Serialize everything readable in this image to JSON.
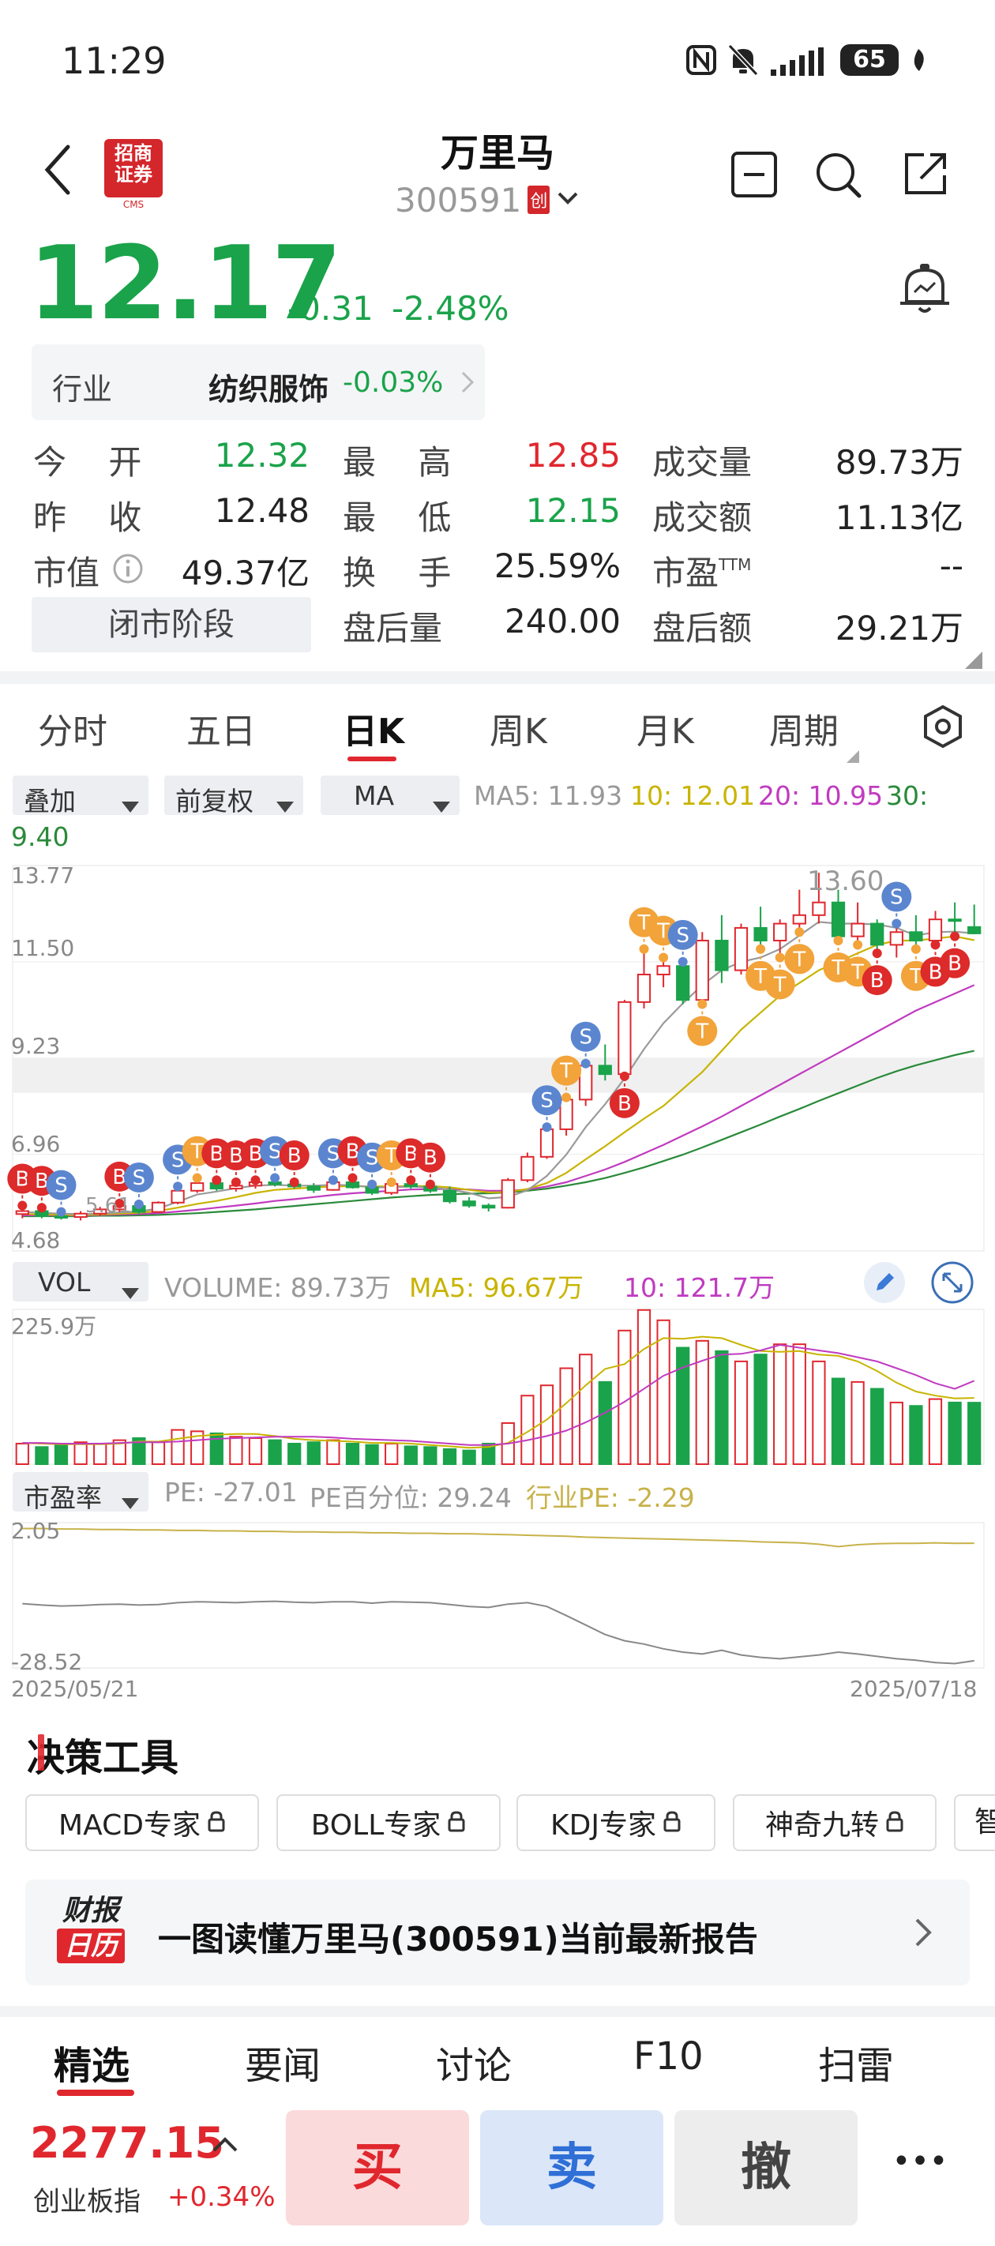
{
  "status_bar": {
    "time": "11:29",
    "battery": "65"
  },
  "header": {
    "logo_top": "招商",
    "logo_bottom": "证券",
    "logo_small": "CMS",
    "title": "万里马",
    "code": "300591",
    "board_badge": "创"
  },
  "price": {
    "last": "12.17",
    "change": "-0.31",
    "change_pct": "-2.48%"
  },
  "industry": {
    "label": "行业",
    "name": "纺织服饰",
    "change": "-0.03%"
  },
  "stats": [
    [
      {
        "k": "今    开",
        "v": "12.32",
        "c": "green"
      },
      {
        "k": "最    高",
        "v": "12.85",
        "c": "red"
      },
      {
        "k": "成交量",
        "v": "89.73万",
        "c": "dark"
      }
    ],
    [
      {
        "k": "昨    收",
        "v": "12.48",
        "c": "dark"
      },
      {
        "k": "最    低",
        "v": "12.15",
        "c": "green"
      },
      {
        "k": "成交额",
        "v": "11.13亿",
        "c": "dark"
      }
    ],
    [
      {
        "k": "市值",
        "v": "49.37亿",
        "c": "dark"
      },
      {
        "k": "换    手",
        "v": "25.59%",
        "c": "dark"
      },
      {
        "k": "市盈TTM",
        "v": "--",
        "c": "dark"
      }
    ],
    [
      {
        "k": "",
        "v": "",
        "c": "dark"
      },
      {
        "k": "盘后量",
        "v": "240.00",
        "c": "dark"
      },
      {
        "k": "盘后额",
        "v": "29.21万",
        "c": "dark"
      }
    ]
  ],
  "phase_button": "闭市阶段",
  "pe_ttm_label": "市盈",
  "pe_ttm_sup": "TTM",
  "chart_tabs": [
    "分时",
    "五日",
    "日K",
    "周K",
    "月K",
    "周期"
  ],
  "active_tab": 2,
  "indicator_bar": {
    "overlay": "叠加",
    "adjust": "前复权",
    "ma": "MA",
    "ma5": "MA5: 11.93",
    "ma10": "10: 12.01",
    "ma20": "20: 10.95",
    "ma30": "30:",
    "ma30_value": "9.40"
  },
  "price_axis": {
    "top": "13.77",
    "l2": "11.50",
    "l3": "9.23",
    "l4": "6.96",
    "bottom": "4.68"
  },
  "annotations": {
    "max": "13.60",
    "min": "5.61"
  },
  "vol_bar": {
    "label": "VOL",
    "volume": "VOLUME: 89.73万",
    "ma5": "MA5: 96.67万",
    "ma10": "10: 121.7万",
    "axis_top": "225.9万"
  },
  "pe_bar": {
    "label": "市盈率",
    "pe": "PE: -27.01",
    "pct": "PE百分位: 29.24",
    "industry": "行业PE: -2.29",
    "axis_top": "2.05",
    "axis_bottom": "-28.52"
  },
  "dates": {
    "start": "2025/05/21",
    "end": "2025/07/18"
  },
  "tools": {
    "title": "决策工具",
    "chips": [
      "MACD专家",
      "BOLL专家",
      "KDJ专家",
      "神奇九转",
      "智"
    ]
  },
  "report": {
    "badge_top": "财报",
    "badge_bottom": "日历",
    "text": "一图读懂万里马(300591)当前最新报告"
  },
  "bottom_tabs": [
    "精选",
    "要闻",
    "讨论",
    "F10",
    "扫雷"
  ],
  "index": {
    "value": "2277.15",
    "name": "创业板指",
    "change": "+0.34%"
  },
  "actions": {
    "buy": "买",
    "sell": "卖",
    "cancel": "撤",
    "more": "•••"
  },
  "colors": {
    "up": "#e0272e",
    "down": "#1aa34a",
    "ma5": "#c8b400",
    "ma10": "#c03bc0",
    "ma30": "#2a8a3a",
    "pe": "#888888",
    "industry_pe": "#c8b24a"
  },
  "chart_data": [
    {
      "type": "candlestick",
      "x": [
        "2025/05/21",
        "2025/07/18"
      ],
      "ylim": [
        4.68,
        13.77
      ],
      "ohlc": [
        [
          5.55,
          5.75,
          5.45,
          5.62
        ],
        [
          5.62,
          5.7,
          5.45,
          5.5
        ],
        [
          5.5,
          5.6,
          5.42,
          5.48
        ],
        [
          5.48,
          5.62,
          5.4,
          5.56
        ],
        [
          5.56,
          5.72,
          5.5,
          5.66
        ],
        [
          5.66,
          5.8,
          5.6,
          5.74
        ],
        [
          5.74,
          5.78,
          5.55,
          5.6
        ],
        [
          5.6,
          5.85,
          5.58,
          5.82
        ],
        [
          5.82,
          6.2,
          5.78,
          6.1
        ],
        [
          6.1,
          6.4,
          6.05,
          6.28
        ],
        [
          6.28,
          6.35,
          6.1,
          6.15
        ],
        [
          6.15,
          6.3,
          6.08,
          6.22
        ],
        [
          6.22,
          6.35,
          6.15,
          6.3
        ],
        [
          6.3,
          6.4,
          6.2,
          6.25
        ],
        [
          6.25,
          6.3,
          6.15,
          6.2
        ],
        [
          6.2,
          6.28,
          6.05,
          6.12
        ],
        [
          6.12,
          6.35,
          6.1,
          6.3
        ],
        [
          6.3,
          6.4,
          6.15,
          6.18
        ],
        [
          6.18,
          6.25,
          6.0,
          6.05
        ],
        [
          6.05,
          6.3,
          6.0,
          6.26
        ],
        [
          6.26,
          6.35,
          6.15,
          6.2
        ],
        [
          6.2,
          6.25,
          6.05,
          6.1
        ],
        [
          6.1,
          6.2,
          5.8,
          5.85
        ],
        [
          5.85,
          5.95,
          5.7,
          5.75
        ],
        [
          5.75,
          5.8,
          5.61,
          5.7
        ],
        [
          5.7,
          6.4,
          5.68,
          6.35
        ],
        [
          6.35,
          7.0,
          6.3,
          6.9
        ],
        [
          6.9,
          7.6,
          6.85,
          7.55
        ],
        [
          7.55,
          8.3,
          7.4,
          8.25
        ],
        [
          8.25,
          9.1,
          8.1,
          9.05
        ],
        [
          9.05,
          9.55,
          8.7,
          8.85
        ],
        [
          8.85,
          10.6,
          8.8,
          10.55
        ],
        [
          10.55,
          11.8,
          10.4,
          11.2
        ],
        [
          11.2,
          11.6,
          10.9,
          11.4
        ],
        [
          11.4,
          11.5,
          10.5,
          10.6
        ],
        [
          10.6,
          12.2,
          10.5,
          12.0
        ],
        [
          12.0,
          12.6,
          11.0,
          11.3
        ],
        [
          11.3,
          12.4,
          11.2,
          12.3
        ],
        [
          12.3,
          12.8,
          11.8,
          12.0
        ],
        [
          12.0,
          12.5,
          11.6,
          12.4
        ],
        [
          12.4,
          13.2,
          12.2,
          12.6
        ],
        [
          12.6,
          13.6,
          12.4,
          12.9
        ],
        [
          12.9,
          13.2,
          12.0,
          12.1
        ],
        [
          12.1,
          12.9,
          11.9,
          12.4
        ],
        [
          12.4,
          12.5,
          11.7,
          11.9
        ],
        [
          11.9,
          12.4,
          11.6,
          12.2
        ],
        [
          12.2,
          12.6,
          11.8,
          12.0
        ],
        [
          12.0,
          12.7,
          11.9,
          12.5
        ],
        [
          12.5,
          12.9,
          12.1,
          12.48
        ],
        [
          12.32,
          12.85,
          12.15,
          12.17
        ]
      ],
      "ma5": [
        5.6,
        5.58,
        5.56,
        5.55,
        5.56,
        5.59,
        5.61,
        5.68,
        5.84,
        6.01,
        6.08,
        6.16,
        6.22,
        6.24,
        6.22,
        6.22,
        6.24,
        6.23,
        6.18,
        6.18,
        6.2,
        6.18,
        6.13,
        6.05,
        5.92,
        5.95,
        6.11,
        6.45,
        6.95,
        7.6,
        8.14,
        8.75,
        9.44,
        10.05,
        10.52,
        10.95,
        11.3,
        11.5,
        11.6,
        11.8,
        12.12,
        12.44,
        12.4,
        12.4,
        12.38,
        12.3,
        12.12,
        12.2,
        12.21,
        12.17
      ],
      "ma10": [
        5.55,
        5.54,
        5.53,
        5.53,
        5.54,
        5.56,
        5.58,
        5.62,
        5.7,
        5.79,
        5.86,
        5.95,
        6.05,
        6.12,
        6.15,
        6.18,
        6.2,
        6.21,
        6.2,
        6.2,
        6.21,
        6.21,
        6.18,
        6.12,
        6.06,
        6.07,
        6.14,
        6.28,
        6.52,
        6.84,
        7.15,
        7.48,
        7.8,
        8.1,
        8.5,
        8.9,
        9.4,
        9.9,
        10.3,
        10.7,
        11.0,
        11.3,
        11.5,
        11.7,
        11.9,
        12.0,
        12.0,
        12.05,
        12.1,
        12.01
      ],
      "ma20": [
        5.52,
        5.52,
        5.52,
        5.52,
        5.53,
        5.54,
        5.55,
        5.57,
        5.61,
        5.65,
        5.7,
        5.75,
        5.8,
        5.86,
        5.9,
        5.95,
        6.0,
        6.04,
        6.07,
        6.1,
        6.13,
        6.14,
        6.14,
        6.13,
        6.1,
        6.1,
        6.13,
        6.2,
        6.3,
        6.45,
        6.6,
        6.78,
        6.98,
        7.18,
        7.4,
        7.62,
        7.85,
        8.1,
        8.35,
        8.6,
        8.85,
        9.1,
        9.35,
        9.6,
        9.85,
        10.1,
        10.35,
        10.55,
        10.75,
        10.95
      ],
      "ma30": [
        5.5,
        5.5,
        5.5,
        5.5,
        5.51,
        5.51,
        5.52,
        5.53,
        5.55,
        5.57,
        5.6,
        5.63,
        5.66,
        5.7,
        5.74,
        5.78,
        5.82,
        5.86,
        5.9,
        5.94,
        5.97,
        6.0,
        6.02,
        6.03,
        6.04,
        6.06,
        6.1,
        6.15,
        6.22,
        6.3,
        6.4,
        6.52,
        6.65,
        6.8,
        6.95,
        7.12,
        7.3,
        7.48,
        7.66,
        7.85,
        8.03,
        8.22,
        8.4,
        8.58,
        8.76,
        8.92,
        9.06,
        9.18,
        9.3,
        9.4
      ],
      "signals": [
        {
          "i": 0,
          "t": "B",
          "c": "red"
        },
        {
          "i": 1,
          "t": "B",
          "c": "red"
        },
        {
          "i": 2,
          "t": "S",
          "c": "blue"
        },
        {
          "i": 5,
          "t": "B",
          "c": "red"
        },
        {
          "i": 6,
          "t": "S",
          "c": "blue"
        },
        {
          "i": 8,
          "t": "S",
          "c": "blue"
        },
        {
          "i": 9,
          "t": "T",
          "c": "orange"
        },
        {
          "i": 10,
          "t": "B",
          "c": "red"
        },
        {
          "i": 11,
          "t": "B",
          "c": "red"
        },
        {
          "i": 12,
          "t": "B",
          "c": "red"
        },
        {
          "i": 13,
          "t": "S",
          "c": "blue"
        },
        {
          "i": 14,
          "t": "B",
          "c": "red"
        },
        {
          "i": 16,
          "t": "S",
          "c": "blue"
        },
        {
          "i": 17,
          "t": "B",
          "c": "red"
        },
        {
          "i": 18,
          "t": "S",
          "c": "blue"
        },
        {
          "i": 19,
          "t": "T",
          "c": "orange"
        },
        {
          "i": 20,
          "t": "B",
          "c": "red"
        },
        {
          "i": 21,
          "t": "B",
          "c": "red"
        },
        {
          "i": 27,
          "t": "S",
          "c": "blue"
        },
        {
          "i": 28,
          "t": "T",
          "c": "orange"
        },
        {
          "i": 29,
          "t": "S",
          "c": "blue"
        },
        {
          "i": 31,
          "t": "B",
          "c": "red"
        },
        {
          "i": 32,
          "t": "T",
          "c": "orange"
        },
        {
          "i": 33,
          "t": "T",
          "c": "orange"
        },
        {
          "i": 34,
          "t": "S",
          "c": "blue"
        },
        {
          "i": 35,
          "t": "T",
          "c": "orange"
        },
        {
          "i": 38,
          "t": "T",
          "c": "orange"
        },
        {
          "i": 39,
          "t": "T",
          "c": "orange"
        },
        {
          "i": 40,
          "t": "T",
          "c": "orange"
        },
        {
          "i": 42,
          "t": "T",
          "c": "orange"
        },
        {
          "i": 43,
          "t": "T",
          "c": "orange"
        },
        {
          "i": 44,
          "t": "B",
          "c": "red"
        },
        {
          "i": 45,
          "t": "S",
          "c": "blue"
        },
        {
          "i": 46,
          "t": "T",
          "c": "orange"
        },
        {
          "i": 47,
          "t": "B",
          "c": "red"
        },
        {
          "i": 48,
          "t": "B",
          "c": "red"
        }
      ]
    },
    {
      "type": "bar",
      "title": "VOL",
      "ylim": [
        0,
        225.9
      ],
      "values": [
        30,
        25,
        28,
        32,
        30,
        35,
        38,
        32,
        50,
        48,
        45,
        40,
        38,
        35,
        30,
        32,
        35,
        30,
        28,
        30,
        26,
        25,
        22,
        20,
        30,
        60,
        100,
        115,
        140,
        160,
        120,
        195,
        225,
        210,
        170,
        180,
        165,
        150,
        160,
        175,
        175,
        150,
        125,
        120,
        110,
        90,
        85,
        95,
        90,
        89.73
      ],
      "up": [
        1,
        0,
        0,
        1,
        1,
        1,
        0,
        1,
        1,
        1,
        0,
        1,
        1,
        0,
        0,
        0,
        1,
        0,
        0,
        1,
        0,
        0,
        0,
        0,
        0,
        1,
        1,
        1,
        1,
        1,
        0,
        1,
        1,
        1,
        0,
        1,
        0,
        1,
        0,
        1,
        1,
        1,
        0,
        1,
        0,
        1,
        0,
        1,
        0,
        0
      ],
      "ma5": [
        31,
        30,
        29,
        29,
        29,
        30,
        33,
        33,
        37,
        41,
        43,
        44,
        44,
        41,
        37,
        35,
        34,
        33,
        31,
        31,
        30,
        28,
        26,
        24,
        25,
        31,
        47,
        65,
        89,
        115,
        139,
        146,
        168,
        184,
        183,
        186,
        184,
        174,
        165,
        164,
        165,
        160,
        158,
        150,
        136,
        119,
        106,
        100,
        96,
        96.67
      ],
      "ma10": [
        31,
        31,
        30,
        30,
        30,
        31,
        32,
        32,
        33,
        35,
        37,
        38,
        39,
        40,
        40,
        40,
        39,
        37,
        36,
        35,
        34,
        32,
        30,
        28,
        28,
        30,
        35,
        41,
        49,
        61,
        75,
        91,
        110,
        129,
        141,
        151,
        160,
        161,
        166,
        174,
        170,
        166,
        162,
        156,
        150,
        140,
        130,
        118,
        110,
        121.7
      ]
    },
    {
      "type": "line",
      "title": "市盈率",
      "ylim": [
        -28.52,
        2.05
      ],
      "series": [
        {
          "name": "PE",
          "values": [
            -15,
            -15.3,
            -15.5,
            -15.4,
            -15.2,
            -15.1,
            -15.3,
            -15.2,
            -14.8,
            -14.6,
            -14.7,
            -14.8,
            -14.6,
            -14.5,
            -14.7,
            -14.8,
            -14.6,
            -14.6,
            -14.9,
            -14.6,
            -14.7,
            -14.8,
            -15.2,
            -15.6,
            -15.8,
            -15.1,
            -14.8,
            -15.6,
            -17.5,
            -19.5,
            -21.5,
            -22.8,
            -23.5,
            -24.5,
            -25.2,
            -25.6,
            -24.8,
            -25.8,
            -26.3,
            -26.6,
            -26.2,
            -25.8,
            -25.2,
            -25.6,
            -26.1,
            -26.6,
            -26.9,
            -27.4,
            -27.6,
            -27.01
          ]
        },
        {
          "name": "行业PE",
          "values": [
            0.8,
            0.8,
            0.7,
            0.7,
            0.6,
            0.6,
            0.5,
            0.5,
            0.4,
            0.4,
            0.3,
            0.3,
            0.2,
            0.2,
            0.1,
            0.1,
            0.0,
            0.0,
            -0.1,
            -0.1,
            -0.2,
            -0.2,
            -0.3,
            -0.3,
            -0.4,
            -0.5,
            -0.6,
            -0.7,
            -0.8,
            -1.0,
            -1.1,
            -1.2,
            -1.3,
            -1.4,
            -1.5,
            -1.6,
            -1.7,
            -1.8,
            -2.0,
            -2.1,
            -2.2,
            -2.5,
            -3.0,
            -2.6,
            -2.4,
            -2.3,
            -2.3,
            -2.2,
            -2.3,
            -2.29
          ]
        }
      ]
    }
  ]
}
